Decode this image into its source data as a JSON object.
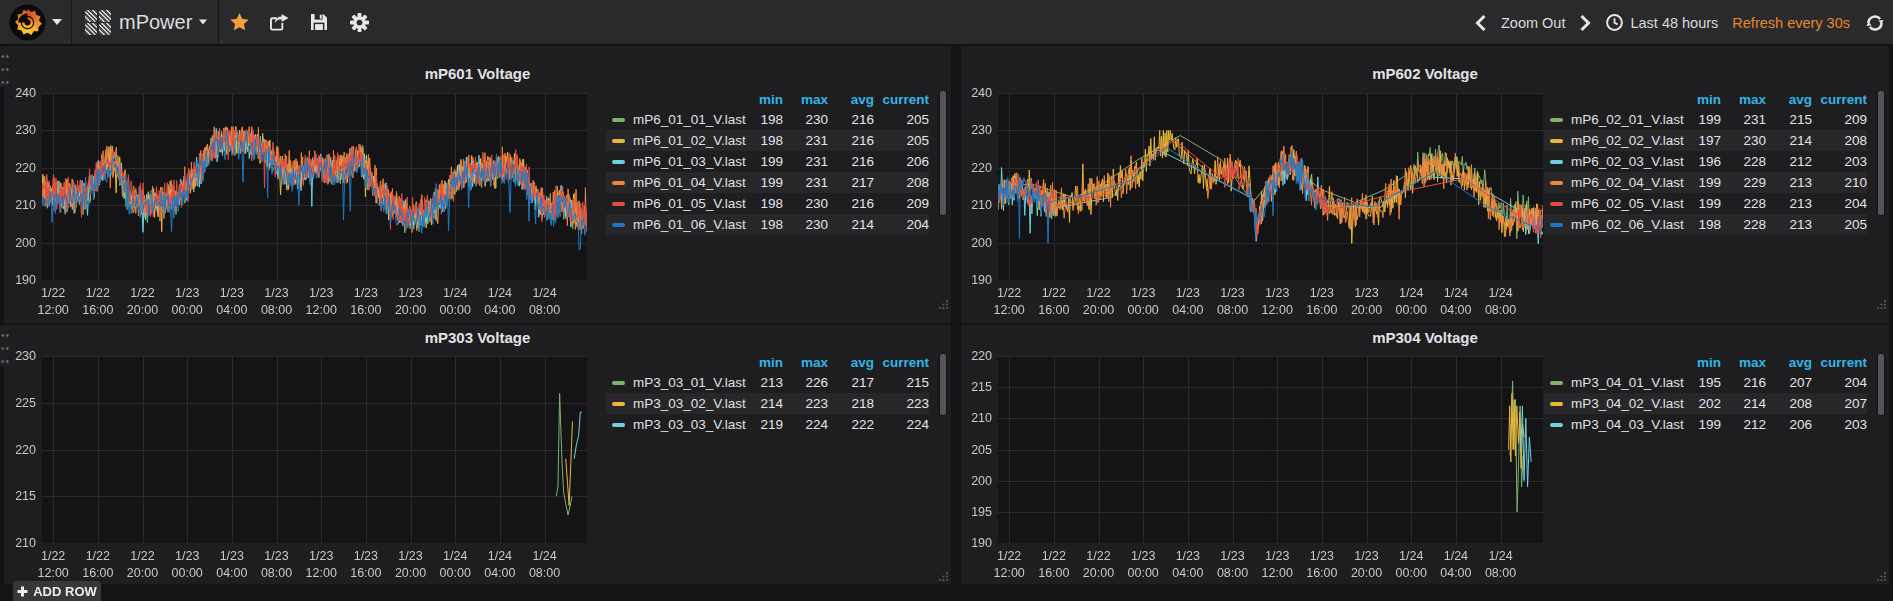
{
  "navbar": {
    "brand": {
      "logo_icon": "grafana-logo",
      "caret_icon": "caret-down"
    },
    "dashboard_picker": {
      "icon": "dashboard-grid",
      "title": "mPower",
      "caret_icon": "caret-down"
    },
    "actions": {
      "star": "star-icon",
      "share": "share-icon",
      "save": "save-icon",
      "settings": "gear-icon"
    },
    "time_controls": {
      "zoom_out_label": "Zoom Out",
      "time_range_label": "Last 48 hours",
      "refresh_label": "Refresh every 30s"
    }
  },
  "add_row": {
    "label": "ADD ROW"
  },
  "colors": {
    "page_bg": "#131316",
    "navbar_bg": "#2a2a2c",
    "panel_bg": "#1e1e21",
    "plot_bg": "#141417",
    "gridline": "#2b2b2e",
    "text": "#d8d9da",
    "legend_header": "#33b5e5",
    "refresh_orange": "#e8862d",
    "star_yellow": "#f0a13c",
    "palette": {
      "green": "#7eb26d",
      "yellow": "#eab839",
      "cyan": "#6ed0e0",
      "orange": "#ef843c",
      "red": "#e24d42",
      "blue": "#1f78c1"
    }
  },
  "legend_columns": [
    "min",
    "max",
    "avg",
    "current"
  ],
  "x_ticks": [
    [
      "1/22",
      "12:00"
    ],
    [
      "1/22",
      "16:00"
    ],
    [
      "1/22",
      "20:00"
    ],
    [
      "1/23",
      "00:00"
    ],
    [
      "1/23",
      "04:00"
    ],
    [
      "1/23",
      "08:00"
    ],
    [
      "1/23",
      "12:00"
    ],
    [
      "1/23",
      "16:00"
    ],
    [
      "1/23",
      "20:00"
    ],
    [
      "1/24",
      "00:00"
    ],
    [
      "1/24",
      "04:00"
    ],
    [
      "1/24",
      "08:00"
    ]
  ],
  "chart_data": [
    {
      "id": "mp601",
      "type": "line",
      "title": "mP601 Voltage",
      "row": 0,
      "col": 0,
      "grid": true,
      "legend_position": "right-table",
      "ylim": [
        190,
        240
      ],
      "y_ticks": [
        240,
        230,
        220,
        210,
        200,
        190
      ],
      "x_range_hours": 48.8,
      "x_tick_first_hour": 1,
      "x_tick_step_hours": 4,
      "baseline": [
        [
          0,
          214
        ],
        [
          2,
          212
        ],
        [
          4,
          213
        ],
        [
          5.5,
          220
        ],
        [
          6.5,
          222
        ],
        [
          8,
          211
        ],
        [
          10,
          210
        ],
        [
          12,
          212
        ],
        [
          14,
          219
        ],
        [
          15.5,
          226
        ],
        [
          17,
          227.5
        ],
        [
          18.5,
          227
        ],
        [
          20,
          224
        ],
        [
          21.5,
          219
        ],
        [
          23,
          218
        ],
        [
          24.5,
          220
        ],
        [
          26,
          219
        ],
        [
          27.5,
          221
        ],
        [
          28.5,
          222
        ],
        [
          30,
          214
        ],
        [
          31.5,
          209
        ],
        [
          33,
          207
        ],
        [
          34.5,
          208
        ],
        [
          36,
          212
        ],
        [
          37.5,
          218
        ],
        [
          39,
          219
        ],
        [
          41,
          220
        ],
        [
          42.5,
          219
        ],
        [
          43.5,
          216
        ],
        [
          44.5,
          210
        ],
        [
          45.5,
          209
        ],
        [
          46.5,
          211
        ],
        [
          47.5,
          208
        ],
        [
          48.8,
          206
        ]
      ],
      "series": [
        {
          "name": "mP6_01_01_V.last",
          "color": "#7eb26d",
          "stats": {
            "min": 198,
            "max": 230,
            "avg": 216,
            "current": 205
          },
          "gen": {
            "seed": 101,
            "amp": 2.9,
            "alt": 2.0,
            "bias": -0.5,
            "spike_p": 0.008,
            "spike_a": 7
          }
        },
        {
          "name": "mP6_01_02_V.last",
          "color": "#eab839",
          "stats": {
            "min": 198,
            "max": 231,
            "avg": 216,
            "current": 205
          },
          "gen": {
            "seed": 102,
            "amp": 3.0,
            "alt": 2.1,
            "bias": 0.3,
            "spike_p": 0.009,
            "spike_a": 7
          }
        },
        {
          "name": "mP6_01_03_V.last",
          "color": "#6ed0e0",
          "stats": {
            "min": 199,
            "max": 231,
            "avg": 216,
            "current": 206
          },
          "gen": {
            "seed": 103,
            "amp": 2.9,
            "alt": 2.0,
            "bias": 0,
            "spike_p": 0.007,
            "spike_a": 7
          }
        },
        {
          "name": "mP6_01_04_V.last",
          "color": "#ef843c",
          "stats": {
            "min": 199,
            "max": 231,
            "avg": 217,
            "current": 208
          },
          "gen": {
            "seed": 104,
            "amp": 3.3,
            "alt": 2.3,
            "bias": 0.8,
            "spike_p": 0.01,
            "spike_a": 8,
            "step": 0.06
          }
        },
        {
          "name": "mP6_01_05_V.last",
          "color": "#e24d42",
          "stats": {
            "min": 198,
            "max": 230,
            "avg": 216,
            "current": 209
          },
          "gen": {
            "seed": 105,
            "amp": 3.3,
            "alt": 2.3,
            "bias": 0.5,
            "spike_p": 0.01,
            "spike_a": 8,
            "step": 0.06
          }
        },
        {
          "name": "mP6_01_06_V.last",
          "color": "#1f78c1",
          "stats": {
            "min": 198,
            "max": 230,
            "avg": 214,
            "current": 204
          },
          "gen": {
            "seed": 106,
            "amp": 3.1,
            "alt": 1.8,
            "bias": -1.0,
            "spike_p": 0.022,
            "spike_a": 11,
            "step": 0.1
          }
        }
      ]
    },
    {
      "id": "mp602",
      "type": "line",
      "title": "mP602 Voltage",
      "row": 0,
      "col": 1,
      "grid": true,
      "legend_position": "right-table",
      "ylim": [
        190,
        240
      ],
      "y_ticks": [
        240,
        230,
        220,
        210,
        200,
        190
      ],
      "x_range_hours": 48.8,
      "x_tick_first_hour": 1,
      "x_tick_step_hours": 4,
      "baseline": [
        [
          0,
          213
        ],
        [
          2,
          215
        ],
        [
          4,
          212
        ],
        [
          6,
          210
        ],
        [
          8,
          212
        ],
        [
          10,
          214
        ],
        [
          12,
          218
        ],
        [
          14,
          224
        ],
        [
          15.5,
          228
        ],
        [
          17,
          222
        ],
        [
          19,
          216
        ],
        [
          21,
          220
        ],
        [
          22.3,
          216
        ],
        [
          23.2,
          205
        ],
        [
          24,
          213
        ],
        [
          25.3,
          220
        ],
        [
          26.5,
          221
        ],
        [
          27.5,
          217
        ],
        [
          28.5,
          212
        ],
        [
          30,
          209
        ],
        [
          31.5,
          207
        ],
        [
          33,
          208
        ],
        [
          34.5,
          210
        ],
        [
          36,
          214
        ],
        [
          37.5,
          218
        ],
        [
          39,
          220
        ],
        [
          41,
          219
        ],
        [
          43,
          215
        ],
        [
          44.5,
          208
        ],
        [
          45.5,
          204
        ],
        [
          46.5,
          207
        ],
        [
          47.5,
          206
        ],
        [
          48.8,
          205
        ]
      ],
      "series": [
        {
          "name": "mP6_02_01_V.last",
          "color": "#7eb26d",
          "stats": {
            "min": 199,
            "max": 231,
            "avg": 215,
            "current": 209
          },
          "gen": {
            "seed": 201,
            "amp": 2.8,
            "alt": 1.9,
            "bias": 2.6,
            "spike_p": 0.006,
            "spike_a": 7,
            "sparse": [
              [
                0,
                35.5,
                3.2
              ]
            ]
          }
        },
        {
          "name": "mP6_02_02_V.last",
          "color": "#eab839",
          "stats": {
            "min": 197,
            "max": 230,
            "avg": 214,
            "current": 208
          },
          "gen": {
            "seed": 202,
            "amp": 3.2,
            "alt": 2.3,
            "bias": 0.3,
            "spike_p": 0.01,
            "spike_a": 8
          }
        },
        {
          "name": "mP6_02_03_V.last",
          "color": "#6ed0e0",
          "stats": {
            "min": 196,
            "max": 228,
            "avg": 212,
            "current": 203
          },
          "gen": {
            "seed": 203,
            "amp": 3.1,
            "alt": 2.0,
            "bias": -0.8,
            "spike_p": 0.012,
            "spike_a": 9,
            "sparse": [
              [
                5,
                19,
                4.2
              ],
              [
                29,
                43,
                5.0
              ]
            ]
          }
        },
        {
          "name": "mP6_02_04_V.last",
          "color": "#ef843c",
          "stats": {
            "min": 199,
            "max": 229,
            "avg": 213,
            "current": 210
          },
          "gen": {
            "seed": 204,
            "amp": 3.3,
            "alt": 2.3,
            "bias": 0.4,
            "spike_p": 0.01,
            "spike_a": 8,
            "sparse": [
              [
                12.5,
                18.5,
                2.8
              ]
            ]
          }
        },
        {
          "name": "mP6_02_05_V.last",
          "color": "#e24d42",
          "stats": {
            "min": 199,
            "max": 228,
            "avg": 213,
            "current": 204
          },
          "gen": {
            "seed": 205,
            "amp": 2.8,
            "alt": 1.8,
            "bias": 0,
            "spike_p": 0.006,
            "spike_a": 8,
            "sparse": [
              [
                5,
                19,
                4.0
              ],
              [
                29.5,
                44,
                5.8
              ]
            ]
          }
        },
        {
          "name": "mP6_02_06_V.last",
          "color": "#1f78c1",
          "stats": {
            "min": 198,
            "max": 228,
            "avg": 213,
            "current": 205
          },
          "gen": {
            "seed": 206,
            "amp": 3.2,
            "alt": 2.0,
            "bias": -0.5,
            "spike_p": 0.01,
            "spike_a": 9,
            "sparse": [
              [
                4.5,
                19,
                3.6
              ],
              [
                28.5,
                44,
                5.2
              ]
            ]
          }
        }
      ]
    },
    {
      "id": "mp303",
      "type": "line",
      "title": "mP303 Voltage",
      "row": 1,
      "col": 0,
      "grid": true,
      "legend_position": "right-table",
      "ylim": [
        210,
        230
      ],
      "y_ticks": [
        230,
        225,
        220,
        215,
        210
      ],
      "x_range_hours": 48.8,
      "x_tick_first_hour": 1,
      "x_tick_step_hours": 4,
      "series": [
        {
          "name": "mP3_03_01_V.last",
          "color": "#7eb26d",
          "stats": {
            "min": 213,
            "max": 226,
            "avg": 217,
            "current": 215
          },
          "points": [
            [
              46.05,
              215
            ],
            [
              46.2,
              216
            ],
            [
              46.35,
              226
            ],
            [
              46.55,
              219
            ],
            [
              46.7,
              215.5
            ],
            [
              46.9,
              214.2
            ],
            [
              47.1,
              213
            ],
            [
              47.3,
              214
            ],
            [
              47.45,
              215
            ]
          ]
        },
        {
          "name": "mP3_03_02_V.last",
          "color": "#eab839",
          "stats": {
            "min": 214,
            "max": 223,
            "avg": 218,
            "current": 223
          },
          "points": [
            [
              46.9,
              219
            ],
            [
              47.05,
              216.5
            ],
            [
              47.2,
              214
            ],
            [
              47.35,
              218.5
            ],
            [
              47.5,
              223
            ]
          ]
        },
        {
          "name": "mP3_03_03_V.last",
          "color": "#6ed0e0",
          "stats": {
            "min": 219,
            "max": 224,
            "avg": 222,
            "current": 224
          },
          "points": [
            [
              47.65,
              219
            ],
            [
              47.85,
              220.5
            ],
            [
              48.05,
              221.5
            ],
            [
              48.2,
              224
            ],
            [
              48.35,
              224
            ]
          ]
        }
      ]
    },
    {
      "id": "mp304",
      "type": "line",
      "title": "mP304 Voltage",
      "row": 1,
      "col": 1,
      "grid": true,
      "legend_position": "right-table",
      "ylim": [
        190,
        220
      ],
      "y_ticks": [
        220,
        215,
        210,
        205,
        200,
        195,
        190
      ],
      "x_range_hours": 48.8,
      "x_tick_first_hour": 1,
      "x_tick_step_hours": 4,
      "series": [
        {
          "name": "mP3_04_01_V.last",
          "color": "#7eb26d",
          "stats": {
            "min": 195,
            "max": 216,
            "avg": 207,
            "current": 204
          },
          "points": [
            [
              45.85,
              204
            ],
            [
              45.98,
              210
            ],
            [
              46.08,
              216
            ],
            [
              46.2,
              205
            ],
            [
              46.33,
              213
            ],
            [
              46.48,
              195
            ],
            [
              46.62,
              203
            ],
            [
              46.75,
              212
            ],
            [
              46.88,
              199
            ],
            [
              47.02,
              204
            ]
          ]
        },
        {
          "name": "mP3_04_02_V.last",
          "color": "#eab839",
          "stats": {
            "min": 202,
            "max": 214,
            "avg": 208,
            "current": 207
          },
          "points": [
            [
              45.72,
              205
            ],
            [
              45.82,
              212
            ],
            [
              45.92,
              203
            ],
            [
              46.02,
              214
            ],
            [
              46.12,
              205
            ],
            [
              46.22,
              213
            ],
            [
              46.33,
              204
            ],
            [
              46.46,
              212
            ],
            [
              46.6,
              206
            ],
            [
              46.72,
              211
            ],
            [
              46.84,
              202
            ],
            [
              46.97,
              209
            ],
            [
              47.12,
              207
            ]
          ]
        },
        {
          "name": "mP3_04_03_V.last",
          "color": "#6ed0e0",
          "stats": {
            "min": 199,
            "max": 212,
            "avg": 206,
            "current": 203
          },
          "points": [
            [
              46.82,
              205
            ],
            [
              46.96,
              212
            ],
            [
              47.1,
              200
            ],
            [
              47.26,
              210
            ],
            [
              47.42,
              199
            ],
            [
              47.58,
              207
            ],
            [
              47.74,
              203
            ]
          ]
        }
      ]
    }
  ]
}
